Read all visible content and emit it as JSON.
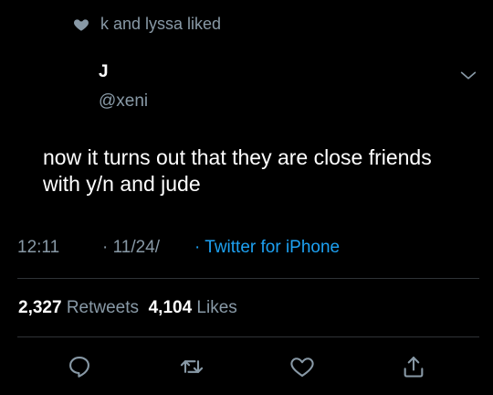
{
  "social_context": {
    "text": "k and lyssa liked",
    "icon": "heart-icon"
  },
  "author": {
    "name": "J",
    "handle": "@xeni"
  },
  "tweet": {
    "text": "now it turns out that they are close friends with y/n and jude"
  },
  "meta": {
    "time": "12:11",
    "date": "· 11/24/",
    "source": "· Twitter for iPhone"
  },
  "stats": {
    "retweets_count": "2,327",
    "retweets_label": "Retweets",
    "likes_count": "4,104",
    "likes_label": "Likes"
  },
  "actions": [
    "reply-icon",
    "retweet-icon",
    "like-icon",
    "share-icon"
  ],
  "colors": {
    "background": "#000000",
    "secondary_text": "#8899a6",
    "link": "#1da1f2",
    "divider": "#2f3336"
  }
}
